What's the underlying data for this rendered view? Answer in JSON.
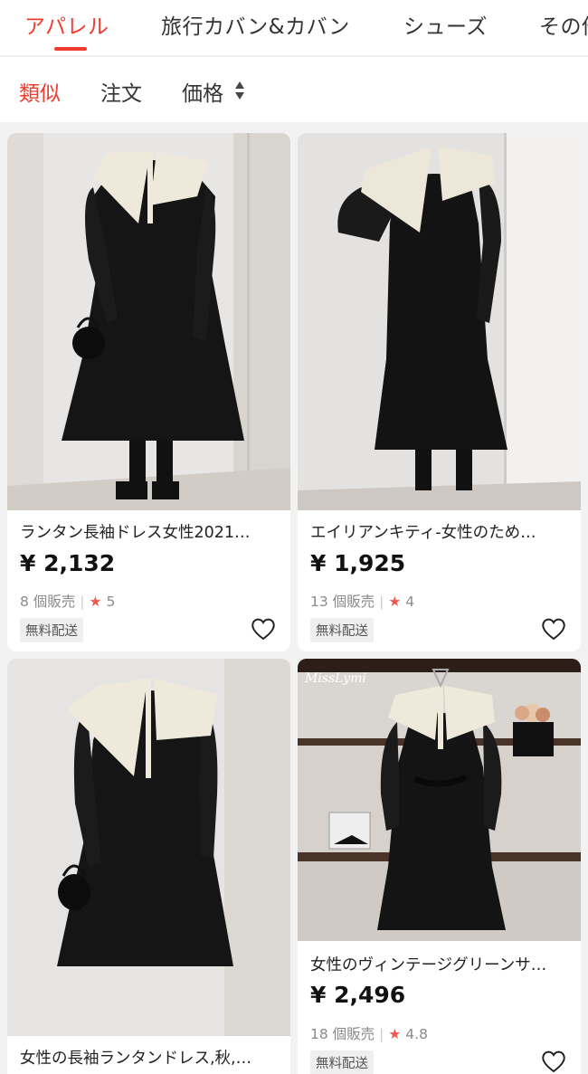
{
  "category_tabs": [
    "アパレル",
    "旅行カバン&カバン",
    "シューズ",
    "その他"
  ],
  "sort_bar": {
    "similar": "類似",
    "orders": "注文",
    "price": "価格"
  },
  "products": [
    {
      "title": "ランタン長袖ドレス女性2021…",
      "price": "¥ 2,132",
      "sold": "8 個販売",
      "rating": "5",
      "shipping": "無料配送"
    },
    {
      "title": "エイリアンキティ-女性のため…",
      "price": "¥ 1,925",
      "sold": "13 個販売",
      "rating": "4",
      "shipping": "無料配送"
    },
    {
      "title": "女性の長袖ランタンドレス,秋,…",
      "price": "",
      "sold": "",
      "rating": "",
      "shipping": ""
    },
    {
      "title": "女性のヴィンテージグリーンサ…",
      "price": "¥ 2,496",
      "sold": "18 個販売",
      "rating": "4.8",
      "shipping": "無料配送",
      "watermark": "MissLymi"
    }
  ],
  "colors": {
    "accent": "#f23b2f",
    "star": "#f0574d"
  }
}
